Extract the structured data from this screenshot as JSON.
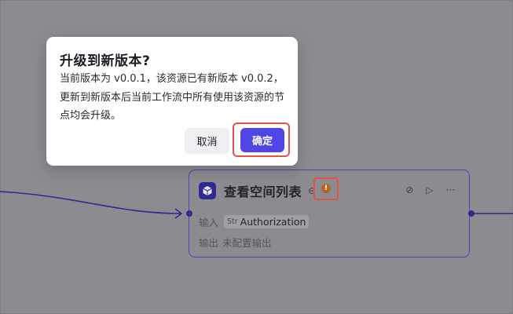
{
  "dialog": {
    "title": "升级到新版本?",
    "body": "当前版本为 v0.0.1，该资源已有新版本 v0.0.2，更新到新版本后当前工作流中所有使用该资源的节点均会升级。",
    "cancel_label": "取消",
    "confirm_label": "确定"
  },
  "node": {
    "title": "查看空间列表",
    "input_label": "输入",
    "input_type": "Str",
    "input_value": "Authorization",
    "output_label": "输出",
    "output_value": "未配置输出",
    "warning_symbol": "!"
  },
  "colors": {
    "accent": "#4f46e5",
    "highlight": "#e0544b",
    "overlay": "#8b8b90"
  }
}
